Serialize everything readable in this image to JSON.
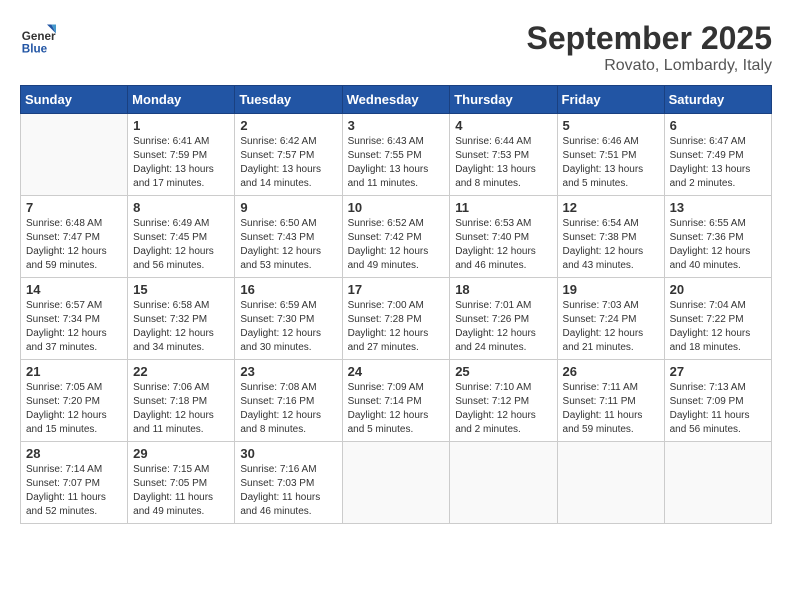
{
  "header": {
    "logo_general": "General",
    "logo_blue": "Blue",
    "month": "September 2025",
    "location": "Rovato, Lombardy, Italy"
  },
  "days_of_week": [
    "Sunday",
    "Monday",
    "Tuesday",
    "Wednesday",
    "Thursday",
    "Friday",
    "Saturday"
  ],
  "weeks": [
    [
      {
        "day": "",
        "info": ""
      },
      {
        "day": "1",
        "info": "Sunrise: 6:41 AM\nSunset: 7:59 PM\nDaylight: 13 hours\nand 17 minutes."
      },
      {
        "day": "2",
        "info": "Sunrise: 6:42 AM\nSunset: 7:57 PM\nDaylight: 13 hours\nand 14 minutes."
      },
      {
        "day": "3",
        "info": "Sunrise: 6:43 AM\nSunset: 7:55 PM\nDaylight: 13 hours\nand 11 minutes."
      },
      {
        "day": "4",
        "info": "Sunrise: 6:44 AM\nSunset: 7:53 PM\nDaylight: 13 hours\nand 8 minutes."
      },
      {
        "day": "5",
        "info": "Sunrise: 6:46 AM\nSunset: 7:51 PM\nDaylight: 13 hours\nand 5 minutes."
      },
      {
        "day": "6",
        "info": "Sunrise: 6:47 AM\nSunset: 7:49 PM\nDaylight: 13 hours\nand 2 minutes."
      }
    ],
    [
      {
        "day": "7",
        "info": "Sunrise: 6:48 AM\nSunset: 7:47 PM\nDaylight: 12 hours\nand 59 minutes."
      },
      {
        "day": "8",
        "info": "Sunrise: 6:49 AM\nSunset: 7:45 PM\nDaylight: 12 hours\nand 56 minutes."
      },
      {
        "day": "9",
        "info": "Sunrise: 6:50 AM\nSunset: 7:43 PM\nDaylight: 12 hours\nand 53 minutes."
      },
      {
        "day": "10",
        "info": "Sunrise: 6:52 AM\nSunset: 7:42 PM\nDaylight: 12 hours\nand 49 minutes."
      },
      {
        "day": "11",
        "info": "Sunrise: 6:53 AM\nSunset: 7:40 PM\nDaylight: 12 hours\nand 46 minutes."
      },
      {
        "day": "12",
        "info": "Sunrise: 6:54 AM\nSunset: 7:38 PM\nDaylight: 12 hours\nand 43 minutes."
      },
      {
        "day": "13",
        "info": "Sunrise: 6:55 AM\nSunset: 7:36 PM\nDaylight: 12 hours\nand 40 minutes."
      }
    ],
    [
      {
        "day": "14",
        "info": "Sunrise: 6:57 AM\nSunset: 7:34 PM\nDaylight: 12 hours\nand 37 minutes."
      },
      {
        "day": "15",
        "info": "Sunrise: 6:58 AM\nSunset: 7:32 PM\nDaylight: 12 hours\nand 34 minutes."
      },
      {
        "day": "16",
        "info": "Sunrise: 6:59 AM\nSunset: 7:30 PM\nDaylight: 12 hours\nand 30 minutes."
      },
      {
        "day": "17",
        "info": "Sunrise: 7:00 AM\nSunset: 7:28 PM\nDaylight: 12 hours\nand 27 minutes."
      },
      {
        "day": "18",
        "info": "Sunrise: 7:01 AM\nSunset: 7:26 PM\nDaylight: 12 hours\nand 24 minutes."
      },
      {
        "day": "19",
        "info": "Sunrise: 7:03 AM\nSunset: 7:24 PM\nDaylight: 12 hours\nand 21 minutes."
      },
      {
        "day": "20",
        "info": "Sunrise: 7:04 AM\nSunset: 7:22 PM\nDaylight: 12 hours\nand 18 minutes."
      }
    ],
    [
      {
        "day": "21",
        "info": "Sunrise: 7:05 AM\nSunset: 7:20 PM\nDaylight: 12 hours\nand 15 minutes."
      },
      {
        "day": "22",
        "info": "Sunrise: 7:06 AM\nSunset: 7:18 PM\nDaylight: 12 hours\nand 11 minutes."
      },
      {
        "day": "23",
        "info": "Sunrise: 7:08 AM\nSunset: 7:16 PM\nDaylight: 12 hours\nand 8 minutes."
      },
      {
        "day": "24",
        "info": "Sunrise: 7:09 AM\nSunset: 7:14 PM\nDaylight: 12 hours\nand 5 minutes."
      },
      {
        "day": "25",
        "info": "Sunrise: 7:10 AM\nSunset: 7:12 PM\nDaylight: 12 hours\nand 2 minutes."
      },
      {
        "day": "26",
        "info": "Sunrise: 7:11 AM\nSunset: 7:11 PM\nDaylight: 11 hours\nand 59 minutes."
      },
      {
        "day": "27",
        "info": "Sunrise: 7:13 AM\nSunset: 7:09 PM\nDaylight: 11 hours\nand 56 minutes."
      }
    ],
    [
      {
        "day": "28",
        "info": "Sunrise: 7:14 AM\nSunset: 7:07 PM\nDaylight: 11 hours\nand 52 minutes."
      },
      {
        "day": "29",
        "info": "Sunrise: 7:15 AM\nSunset: 7:05 PM\nDaylight: 11 hours\nand 49 minutes."
      },
      {
        "day": "30",
        "info": "Sunrise: 7:16 AM\nSunset: 7:03 PM\nDaylight: 11 hours\nand 46 minutes."
      },
      {
        "day": "",
        "info": ""
      },
      {
        "day": "",
        "info": ""
      },
      {
        "day": "",
        "info": ""
      },
      {
        "day": "",
        "info": ""
      }
    ]
  ]
}
